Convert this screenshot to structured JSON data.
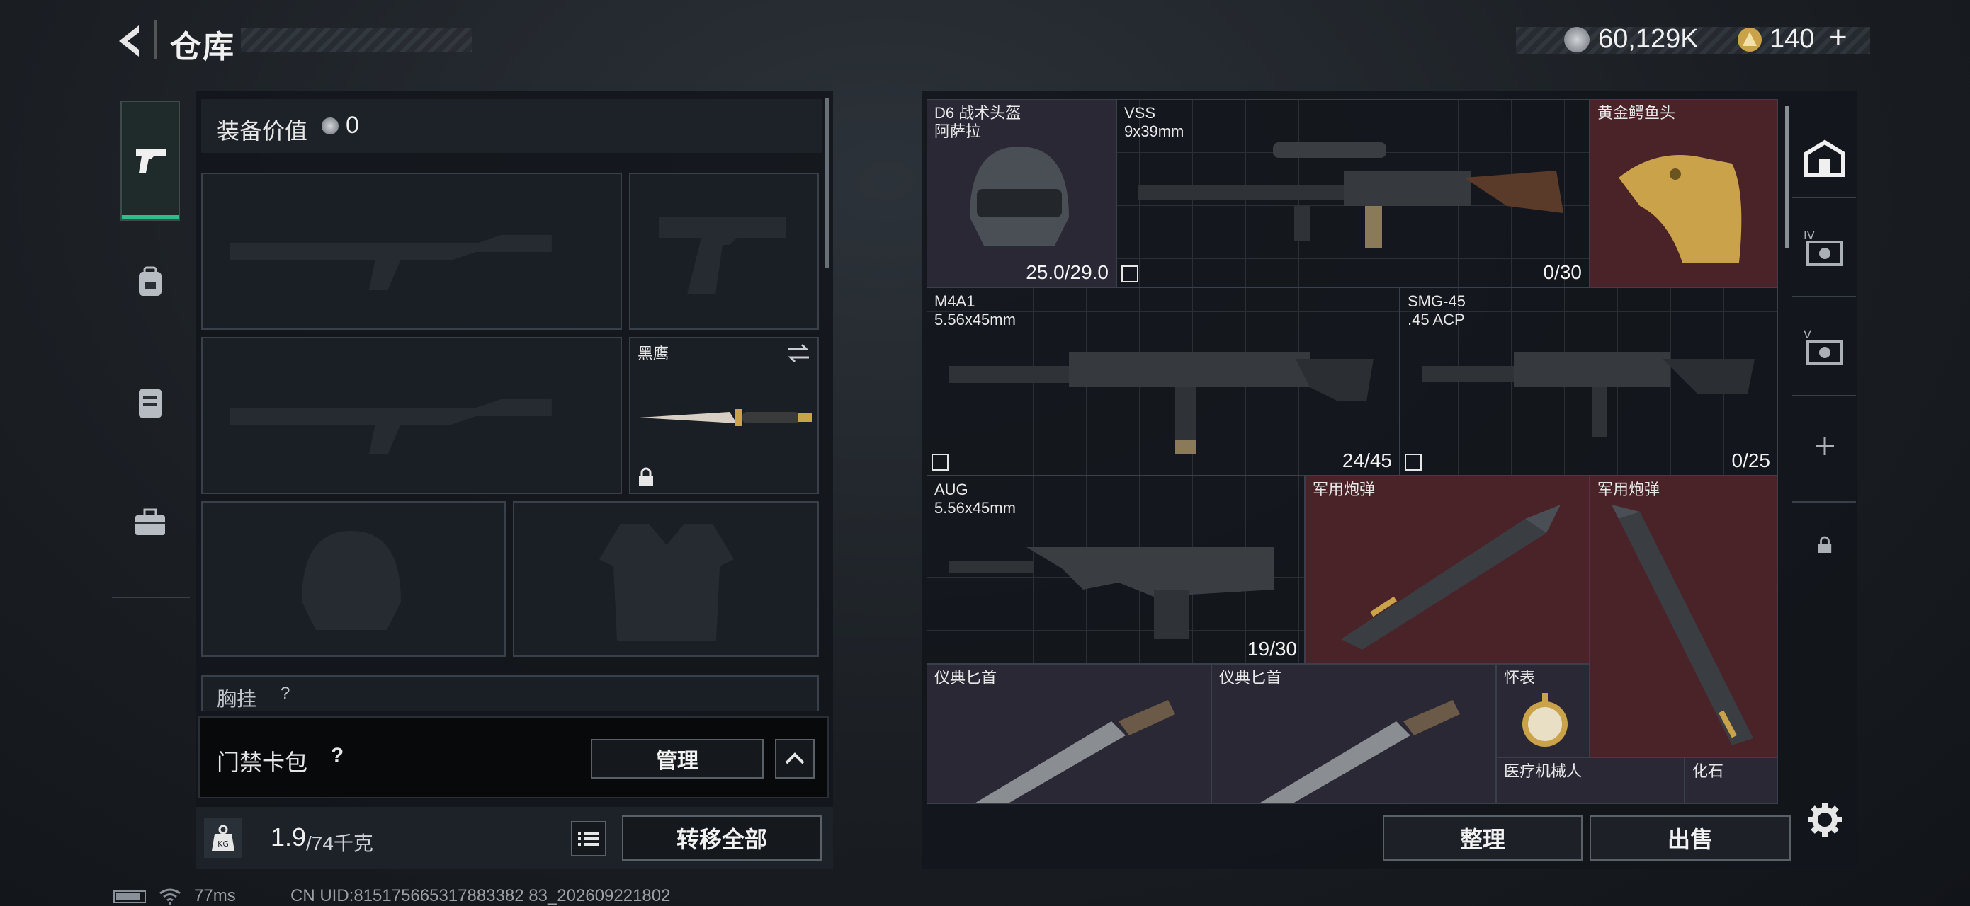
{
  "header": {
    "title": "仓库",
    "currency1": "60,129K",
    "currency2": "140",
    "currency2_plus": "+"
  },
  "loadout": {
    "value_label": "装备价值",
    "value": "0",
    "melee_name": "黑鹰",
    "next_section": "胸挂",
    "next_section_q": "?"
  },
  "keycard": {
    "label": "门禁卡包",
    "help": "?",
    "manage": "管理"
  },
  "weight": {
    "current": "1.9",
    "max": "/74千克",
    "unit_icon": "KG",
    "transfer_all": "转移全部"
  },
  "stash": {
    "items": [
      {
        "name": "D6 战术头盔\n阿萨拉",
        "count": "25.0/29.0"
      },
      {
        "name": "VSS\n9x39mm",
        "count": "0/30"
      },
      {
        "name": "黄金鳄鱼头",
        "count": ""
      },
      {
        "name": "M4A1\n5.56x45mm",
        "count": "24/45"
      },
      {
        "name": "SMG-45\n.45 ACP",
        "count": "0/25"
      },
      {
        "name": "AUG\n5.56x45mm",
        "count": "19/30"
      },
      {
        "name": "军用炮弹",
        "count": ""
      },
      {
        "name": "军用炮弹",
        "count": ""
      },
      {
        "name": "仪典匕首",
        "count": ""
      },
      {
        "name": "仪典匕首",
        "count": ""
      },
      {
        "name": "怀表",
        "count": ""
      },
      {
        "name": "医疗机械人",
        "count": ""
      },
      {
        "name": "化石",
        "count": ""
      }
    ],
    "sort": "整理",
    "sell": "出售"
  },
  "status": {
    "ping": "77ms",
    "uid": "CN UID:815175665317883382 83_202609221802"
  },
  "icons": [
    "back-icon",
    "pistol-icon",
    "backpack-icon",
    "vest-icon",
    "toolbox-icon",
    "stash-home-icon",
    "container-iv-icon",
    "container-v-icon",
    "add-icon",
    "lock-icon",
    "settings-icon",
    "swap-icon",
    "help-icon",
    "chevron-up-icon",
    "list-icon",
    "weight-icon",
    "battery-icon",
    "wifi-icon"
  ],
  "colors": {
    "accent": "#2dbf8a",
    "item_red": "#4a2328",
    "item_purple": "#2a2835",
    "item_gray": "#1d2127"
  }
}
